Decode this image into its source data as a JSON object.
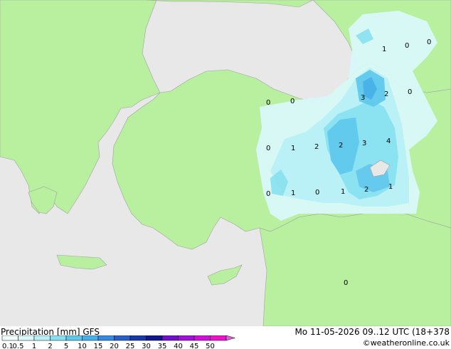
{
  "footer": {
    "title": "Precipitation [mm]  GFS",
    "datetime": "Mo 11-05-2026 09..12 UTC (18+378",
    "copyright": "©weatheronline.co.uk"
  },
  "legend": {
    "bins": [
      {
        "label": "0.1",
        "color": "#f0fcfc"
      },
      {
        "label": "0.5",
        "color": "#d8f8fa"
      },
      {
        "label": "1",
        "color": "#b8f0f6"
      },
      {
        "label": "2",
        "color": "#88e0f0"
      },
      {
        "label": "5",
        "color": "#60c8ec"
      },
      {
        "label": "10",
        "color": "#48b0e8"
      },
      {
        "label": "15",
        "color": "#3888dc"
      },
      {
        "label": "20",
        "color": "#2860c8"
      },
      {
        "label": "25",
        "color": "#1838a8"
      },
      {
        "label": "30",
        "color": "#10188c"
      },
      {
        "label": "35",
        "color": "#7010c8"
      },
      {
        "label": "40",
        "color": "#a010d8"
      },
      {
        "label": "45",
        "color": "#d010d8"
      },
      {
        "label": "50",
        "color": "#f010c8"
      }
    ],
    "end_color": "#e060e0"
  },
  "map_labels": [
    {
      "value": "1"
    },
    {
      "value": "0"
    },
    {
      "value": "0"
    },
    {
      "value": "3"
    },
    {
      "value": "2"
    },
    {
      "value": "0"
    },
    {
      "value": "0"
    },
    {
      "value": "0"
    },
    {
      "value": "0"
    },
    {
      "value": "1"
    },
    {
      "value": "2"
    },
    {
      "value": "2"
    },
    {
      "value": "3"
    },
    {
      "value": "4"
    },
    {
      "value": "0"
    },
    {
      "value": "1"
    },
    {
      "value": "0"
    },
    {
      "value": "1"
    },
    {
      "value": "2"
    },
    {
      "value": "1"
    },
    {
      "value": "0"
    }
  ],
  "colors": {
    "land": "#b8f0a0",
    "sea": "#e8e8e8",
    "border": "#a0a0a0"
  }
}
